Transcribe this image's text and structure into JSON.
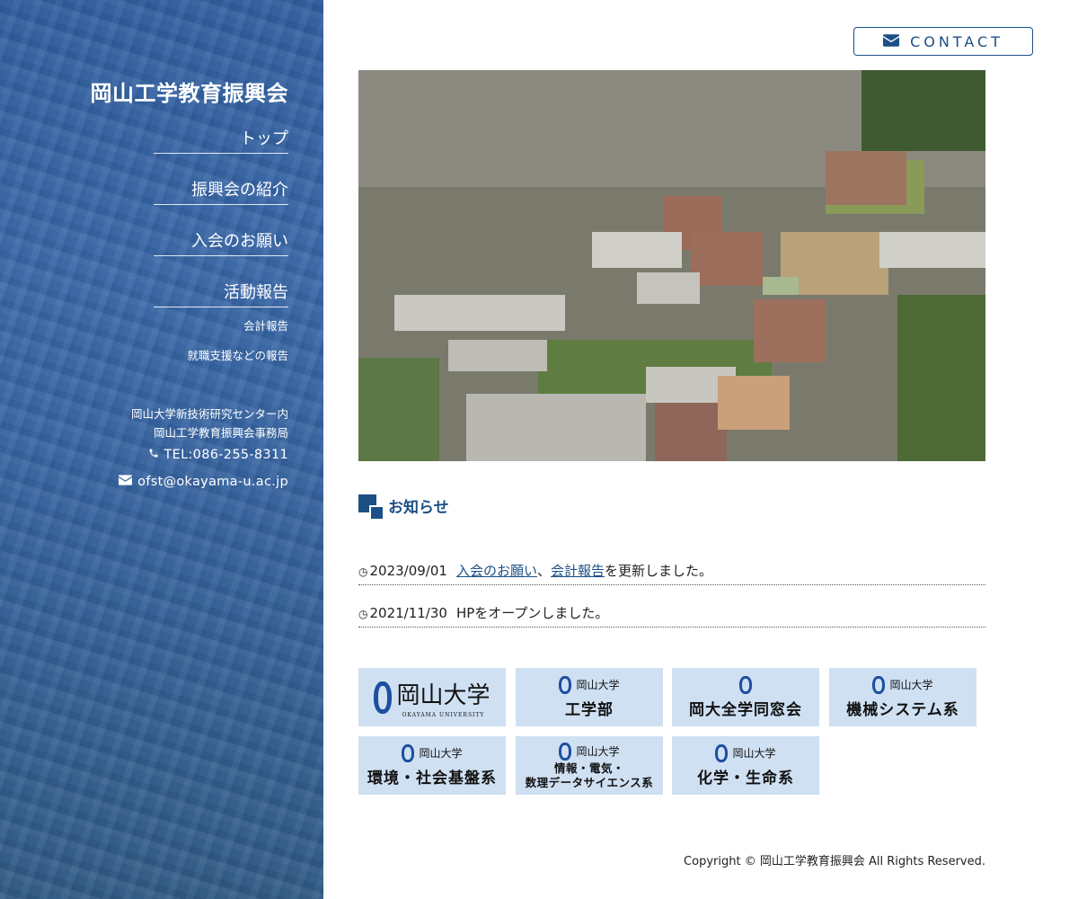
{
  "sidebar": {
    "site_title": "岡山工学教育振興会",
    "nav": [
      {
        "label": "トップ"
      },
      {
        "label": "振興会の紹介"
      },
      {
        "label": "入会のお願い"
      },
      {
        "label": "活動報告"
      }
    ],
    "sub_nav": [
      {
        "label": "会計報告"
      },
      {
        "label": "就職支援などの報告"
      }
    ],
    "address_line1": "岡山大学新技術研究センター内",
    "address_line2": "岡山工学教育振興会事務局",
    "tel": "TEL:086-255-8311",
    "email": "ofst@okayama-u.ac.jp"
  },
  "header": {
    "contact_label": "CONTACT",
    "contact_icon": "envelope-icon"
  },
  "news": {
    "heading": "お知らせ",
    "items": [
      {
        "date": "2023/09/01",
        "link1": "入会のお願い",
        "sep": "、",
        "link2": "会計報告",
        "text": "を更新しました。"
      },
      {
        "date": "2021/11/30",
        "text": "HPをオープンしました。"
      }
    ]
  },
  "banners": [
    {
      "uni": "岡山大学",
      "en": "OKAYAMA UNIVERSITY",
      "main": ""
    },
    {
      "uni": "岡山大学",
      "main": "工学部"
    },
    {
      "uni": "",
      "main": "岡大全学同窓会"
    },
    {
      "uni": "岡山大学",
      "main": "機械システム系"
    },
    {
      "uni": "岡山大学",
      "main": "環境・社会基盤系"
    },
    {
      "uni": "岡山大学",
      "main_line1": "情報・電気・",
      "main_line2": "数理データサイエンス系"
    },
    {
      "uni": "岡山大学",
      "main": "化学・生命系"
    }
  ],
  "footer": {
    "copyright": "Copyright © 岡山工学教育振興会 All Rights Reserved."
  },
  "colors": {
    "accent": "#1c4f86",
    "banner_bg": "#cfe0f3",
    "sidebar_overlay": "#2656a0"
  }
}
